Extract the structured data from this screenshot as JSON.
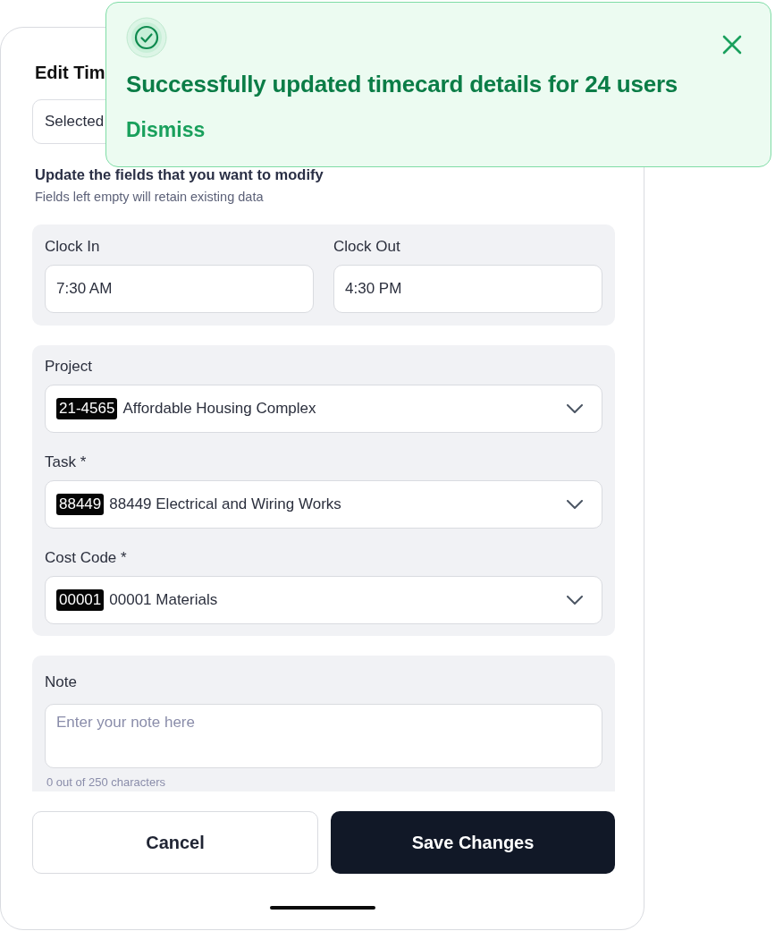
{
  "modal": {
    "title": "Edit Tim",
    "selection": "Selected"
  },
  "toast": {
    "message": "Successfully updated timecard details for 24 users",
    "action": "Dismiss"
  },
  "section": {
    "heading": "Update the fields that you want to modify",
    "hint": "Fields left empty will retain existing data"
  },
  "clock": [
    {
      "label": "Clock In",
      "value": "7:30 AM"
    },
    {
      "label": "Clock Out",
      "value": "4:30 PM"
    }
  ],
  "selects": [
    {
      "label": "Project",
      "code": "21-4565",
      "value": "Affordable Housing Complex"
    },
    {
      "label": "Task *",
      "code": "88449",
      "value": "88449 Electrical and Wiring Works"
    },
    {
      "label": "Cost Code *",
      "code": "00001",
      "value": "00001 Materials"
    }
  ],
  "note": {
    "label": "Note",
    "placeholder": "Enter your note here",
    "counter": "0 out of 250 characters"
  },
  "buttons": [
    {
      "label": "Cancel",
      "kind": "secondary"
    },
    {
      "label": "Save Changes",
      "kind": "primary"
    }
  ]
}
